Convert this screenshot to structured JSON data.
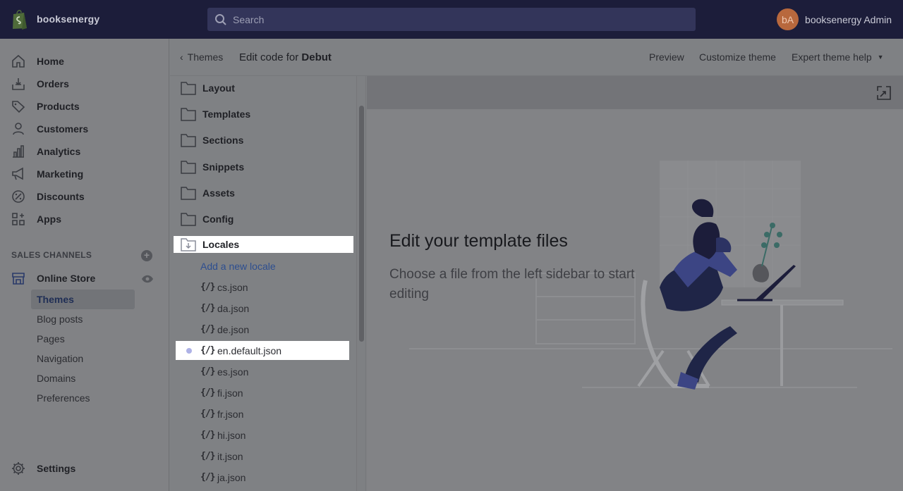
{
  "topbar": {
    "store_name": "booksenergy",
    "search_placeholder": "Search",
    "user_initials": "bA",
    "user_name": "booksenergy Admin",
    "avatar_color": "#b8683d"
  },
  "nav": {
    "items": [
      {
        "label": "Home",
        "icon": "home-icon"
      },
      {
        "label": "Orders",
        "icon": "orders-icon"
      },
      {
        "label": "Products",
        "icon": "tag-icon"
      },
      {
        "label": "Customers",
        "icon": "person-icon"
      },
      {
        "label": "Analytics",
        "icon": "bar-chart-icon"
      },
      {
        "label": "Marketing",
        "icon": "megaphone-icon"
      },
      {
        "label": "Discounts",
        "icon": "discount-icon"
      },
      {
        "label": "Apps",
        "icon": "apps-icon"
      }
    ],
    "sales_channels_header": "SALES CHANNELS",
    "online_store": "Online Store",
    "sub_items": [
      "Themes",
      "Blog posts",
      "Pages",
      "Navigation",
      "Domains",
      "Preferences"
    ],
    "settings": "Settings"
  },
  "subheader": {
    "back_label": "Themes",
    "title_prefix": "Edit code for",
    "theme_name": "Debut",
    "preview": "Preview",
    "customize": "Customize theme",
    "expert_help": "Expert theme help"
  },
  "filetree": {
    "folders": [
      "Layout",
      "Templates",
      "Sections",
      "Snippets",
      "Assets",
      "Config",
      "Locales"
    ],
    "add_locale": "Add a new locale",
    "file_icon_glyph": "{/}",
    "files": [
      "cs.json",
      "da.json",
      "de.json",
      "en.default.json",
      "es.json",
      "fi.json",
      "fr.json",
      "hi.json",
      "it.json",
      "ja.json"
    ]
  },
  "editor": {
    "empty_title": "Edit your template files",
    "empty_subtitle": "Choose a file from the left sidebar to start editing"
  }
}
